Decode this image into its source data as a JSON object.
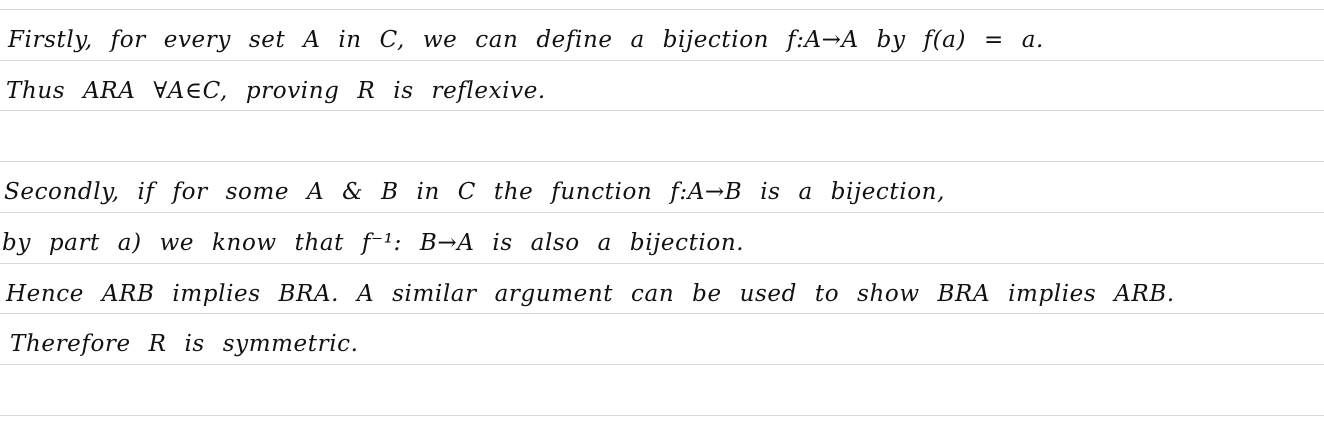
{
  "notes": {
    "lines": [
      "Firstly,  for every set A in C,  we can define a bijection f:A→A by f(a) = a.",
      "Thus ARA ∀A∈C,  proving R is reflexive.",
      "Secondly, if for some A & B in C the function f:A→B is a bijection,",
      "by part a) we know that f⁻¹: B→A is also a bijection.",
      "Hence ARB implies BRA. A similar argument can be used to show BRA implies ARB.",
      "Therefore R is symmetric."
    ]
  },
  "colors": {
    "ink": "#111111",
    "rule": "#d9d9d9",
    "paper": "#ffffff"
  }
}
